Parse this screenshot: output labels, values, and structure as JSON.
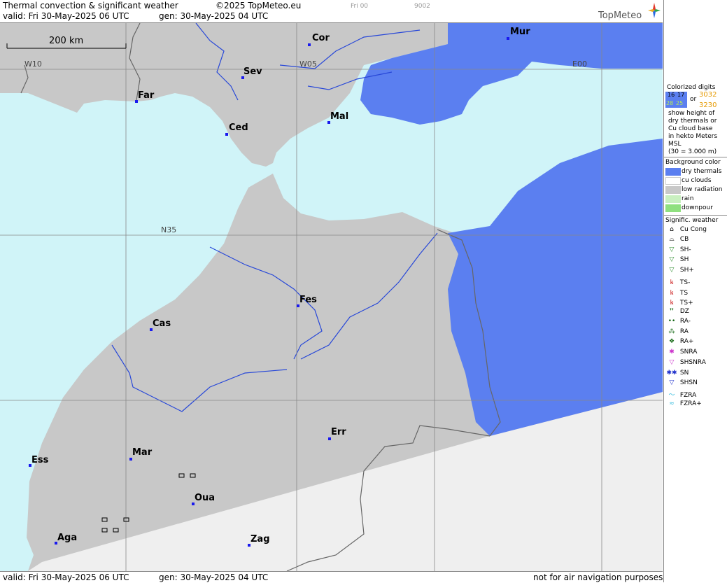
{
  "header": {
    "title": "Thermal convection & significant weather",
    "copyright": "©2025 TopMeteo.eu",
    "frame_label": "Fri 00",
    "frame_code": "9002",
    "valid": "valid:  Fri  30-May-2025  06 UTC",
    "gen": "gen: 30-May-2025 04 UTC",
    "brand": "TopMeteo"
  },
  "footer": {
    "valid": "valid:  Fri  30-May-2025  06 UTC",
    "gen": "gen: 30-May-2025 04 UTC",
    "disclaimer": "not for air navigation purposes"
  },
  "map": {
    "scale": "200 km",
    "grid_labels": {
      "w10": "W10",
      "w05": "W05",
      "e00": "E00",
      "n35": "N35"
    },
    "cities": [
      {
        "id": "cor",
        "name": "Cor"
      },
      {
        "id": "mur",
        "name": "Mur"
      },
      {
        "id": "sev",
        "name": "Sev"
      },
      {
        "id": "far",
        "name": "Far"
      },
      {
        "id": "mal",
        "name": "Mal"
      },
      {
        "id": "ced",
        "name": "Ced"
      },
      {
        "id": "fes",
        "name": "Fes"
      },
      {
        "id": "cas",
        "name": "Cas"
      },
      {
        "id": "err",
        "name": "Err"
      },
      {
        "id": "mar",
        "name": "Mar"
      },
      {
        "id": "ess",
        "name": "Ess"
      },
      {
        "id": "oua",
        "name": "Oua"
      },
      {
        "id": "aga",
        "name": "Aga"
      },
      {
        "id": "zag",
        "name": "Zag"
      }
    ],
    "colors": {
      "sea": "#d0f4f8",
      "land": "#c8c8c8",
      "dry": "#5b7ff0",
      "nodata": "#efefef",
      "river": "#2848d8",
      "border": "#666666"
    }
  },
  "legend": {
    "digits_title": "Colorized digits",
    "digit_a1": "16",
    "digit_a2": "17",
    "digit_b1": "28",
    "digit_b2": "25",
    "or": "or",
    "digit_c": "3032",
    "digit_d": "3230",
    "digits_desc": [
      "show height of",
      "dry thermals or",
      "Cu cloud base",
      "in hekto Meters",
      "MSL",
      "(30 = 3.000 m)"
    ],
    "bg_title": "Background color",
    "bg_items": [
      {
        "label": "dry thermals",
        "color": "#5b7ff0"
      },
      {
        "label": "cu clouds",
        "color": "#ffffff"
      },
      {
        "label": "low radiation",
        "color": "#c8c8c8"
      },
      {
        "label": "rain",
        "color": "#c9f0c0"
      },
      {
        "label": "downpour",
        "color": "#8fe07f"
      }
    ],
    "sig_title": "Signific. weather",
    "sig_items": [
      {
        "label": "Cu Cong",
        "symbol": "⌂",
        "color": "#000000"
      },
      {
        "label": "CB",
        "symbol": "⌓",
        "color": "#000000"
      },
      {
        "label": "SH-",
        "symbol": "▽",
        "color": "#2a8a2a"
      },
      {
        "label": "SH",
        "symbol": "▽",
        "color": "#2a8a2a"
      },
      {
        "label": "SH+",
        "symbol": "▽",
        "color": "#2a8a2a"
      },
      {
        "label": "TS-",
        "symbol": "ꝃ",
        "color": "#cc2222"
      },
      {
        "label": "TS",
        "symbol": "ꝃ",
        "color": "#cc2222"
      },
      {
        "label": "TS+",
        "symbol": "ꝃ",
        "color": "#cc2222"
      },
      {
        "label": "DZ",
        "symbol": "❜❜",
        "color": "#116611"
      },
      {
        "label": "RA-",
        "symbol": "••",
        "color": "#116611"
      },
      {
        "label": "RA",
        "symbol": "⁂",
        "color": "#116611"
      },
      {
        "label": "RA+",
        "symbol": "❖",
        "color": "#116611"
      },
      {
        "label": "SNRA",
        "symbol": "✱",
        "color": "#cc33cc"
      },
      {
        "label": "SHSNRA",
        "symbol": "▽",
        "color": "#cc33cc"
      },
      {
        "label": "SN",
        "symbol": "✱✱",
        "color": "#2233cc"
      },
      {
        "label": "SHSN",
        "symbol": "▽",
        "color": "#2233cc"
      },
      {
        "label": "FZRA",
        "symbol": "〜",
        "color": "#33bbdd"
      },
      {
        "label": "FZRA+",
        "symbol": "≈",
        "color": "#33bbdd"
      }
    ]
  }
}
